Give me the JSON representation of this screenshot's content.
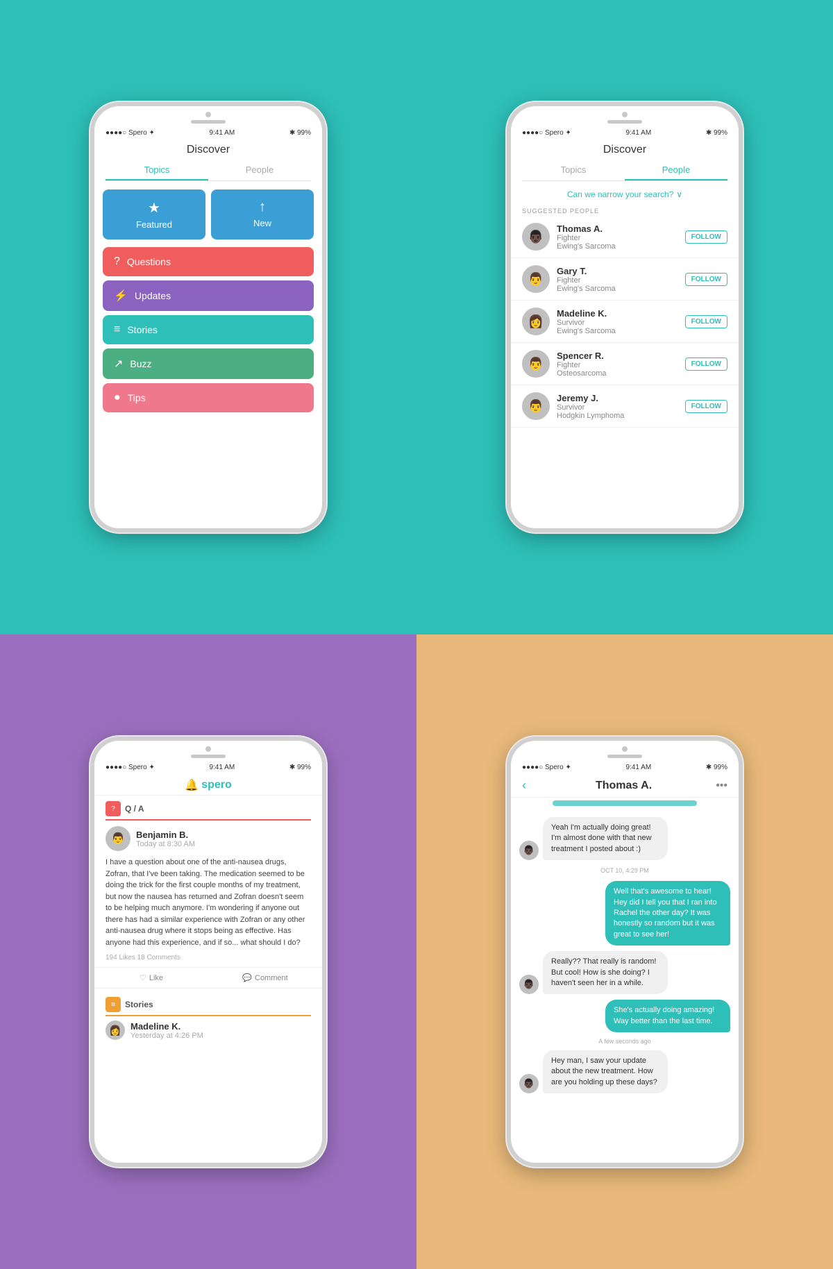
{
  "colors": {
    "teal": "#2DBFB8",
    "red": "#F05D5D",
    "purple": "#8B62C0",
    "green": "#4CAF82",
    "pink": "#F0788C",
    "blue": "#3B9ED4",
    "bg_tl": "#2DBFB8",
    "bg_tr": "#2DBFB8",
    "bg_bl": "#9B6FBF",
    "bg_br": "#E8B97A"
  },
  "phone1": {
    "status": {
      "carrier": "●●●●○ Spero ✦",
      "time": "9:41 AM",
      "battery": "✱ 99%"
    },
    "header": "Discover",
    "tabs": [
      {
        "label": "Topics",
        "active": true
      },
      {
        "label": "People",
        "active": false
      }
    ],
    "featured_buttons": [
      {
        "label": "Featured",
        "icon": "★"
      },
      {
        "label": "New",
        "icon": "↑"
      }
    ],
    "menu_items": [
      {
        "label": "Questions",
        "icon": "?",
        "color": "#F05D5D"
      },
      {
        "label": "Updates",
        "icon": "⚡",
        "color": "#8B62C0"
      },
      {
        "label": "Stories",
        "icon": "≡",
        "color": "#2DBFB8"
      },
      {
        "label": "Buzz",
        "icon": "↗",
        "color": "#4CAF82"
      },
      {
        "label": "Tips",
        "icon": "●",
        "color": "#F0788C"
      }
    ]
  },
  "phone2": {
    "status": {
      "carrier": "●●●●○ Spero ✦",
      "time": "9:41 AM",
      "battery": "✱ 99%"
    },
    "header": "Discover",
    "tabs": [
      {
        "label": "Topics",
        "active": false
      },
      {
        "label": "People",
        "active": true
      }
    ],
    "narrow_search": "Can we narrow your search?",
    "suggested_label": "SUGGESTED PEOPLE",
    "people": [
      {
        "name": "Thomas A.",
        "role": "Fighter",
        "condition": "Ewing's Sarcoma",
        "avatar": "👨🏿"
      },
      {
        "name": "Gary T.",
        "role": "Fighter",
        "condition": "Ewing's Sarcoma",
        "avatar": "👨"
      },
      {
        "name": "Madeline K.",
        "role": "Survivor",
        "condition": "Ewing's Sarcoma",
        "avatar": "👩"
      },
      {
        "name": "Spencer R.",
        "role": "Fighter",
        "condition": "Osteosarcoma",
        "avatar": "👨"
      },
      {
        "name": "Jeremy J.",
        "role": "Survivor",
        "condition": "Hodgkin Lymphoma",
        "avatar": "👨"
      }
    ],
    "follow_label": "FOLLOW"
  },
  "phone3": {
    "status": {
      "carrier": "●●●●○ Spero ✦",
      "time": "9:41 AM",
      "battery": "✱ 99%"
    },
    "logo": "spero",
    "qa_section": "Q / A",
    "post": {
      "author": "Benjamin B.",
      "time": "Today at 8:30 AM",
      "avatar": "👨",
      "body": "I have a question about one of the anti-nausea drugs, Zofran, that I've been taking. The medication seemed to be doing the trick for the first couple months of my treatment, but now the nausea has returned and Zofran doesn't seem to be helping much anymore. I'm wondering if anyone out there has had a similar experience with Zofran or any other anti-nausea drug where it stops being as effective. Has anyone had this experience, and if so... what should I do?",
      "stats": "194 Likes   18 Comments",
      "like_label": "Like",
      "comment_label": "Comment"
    },
    "stories_section": "Stories",
    "mini_post": {
      "author": "Madeline K.",
      "time": "Yesterday at 4:26 PM",
      "avatar": "👩"
    }
  },
  "phone4": {
    "status": {
      "carrier": "●●●●○ Spero ✦",
      "time": "9:41 AM",
      "battery": "✱ 99%"
    },
    "back_label": "‹",
    "chat_title": "Thomas A.",
    "more_label": "•••",
    "messages": [
      {
        "type": "in",
        "text": "Yeah I'm actually doing great! I'm almost done with that new treatment I posted about :)",
        "avatar": "👨🏿"
      },
      {
        "date": "OCT 10, 4:29 PM"
      },
      {
        "type": "out",
        "text": "Well that's awesome to hear! Hey did I tell you that I ran into Rachel the other day? It was honestly so random but it was great to see her!"
      },
      {
        "type": "in",
        "text": "Really?? That really is random! But cool! How is she doing? I haven't seen her in a while.",
        "avatar": "👨🏿"
      },
      {
        "type": "out",
        "text": "She's actually doing amazing! Way better than the last time."
      },
      {
        "timestamp": "A few seconds ago"
      },
      {
        "type": "in",
        "text": "Hey man, I saw your update about the new treatment. How are you holding up these days?",
        "avatar": "👨🏿"
      }
    ]
  }
}
